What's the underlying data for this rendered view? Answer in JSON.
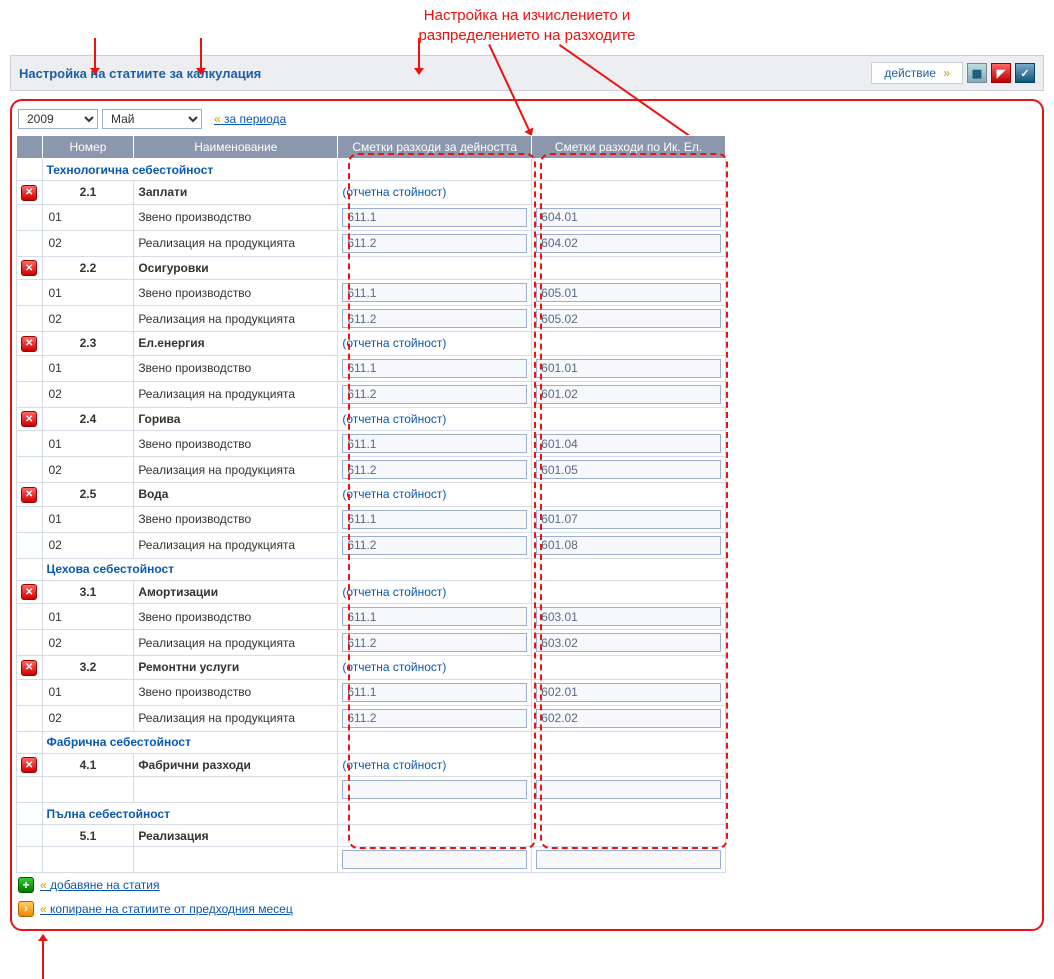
{
  "annotation": {
    "title_line1": "Настройка на изчислението и",
    "title_line2": "разпределението на разходите"
  },
  "header": {
    "title": "Настройка на статиите за калкулация",
    "action_label": "действие"
  },
  "period": {
    "year": "2009",
    "month": "Май",
    "link_text": "за периода"
  },
  "table": {
    "headers": {
      "number": "Номер",
      "name": "Наименование",
      "acct_activity": "Сметки разходи за дейността",
      "acct_econ": "Сметки разходи по Ик. Ел."
    },
    "report_value": "(отчетна стойност)"
  },
  "sections": [
    {
      "title": "Технологична себестойност",
      "items": [
        {
          "num": "2.1",
          "name": "Заплати",
          "report_link": true,
          "rows": [
            {
              "n": "01",
              "nm": "Звено производство",
              "a": "611.1",
              "b": "604.01"
            },
            {
              "n": "02",
              "nm": "Реализация на продукцията",
              "a": "611.2",
              "b": "604.02"
            }
          ]
        },
        {
          "num": "2.2",
          "name": "Осигуровки",
          "report_link": false,
          "rows": [
            {
              "n": "01",
              "nm": "Звено производство",
              "a": "611.1",
              "b": "605.01"
            },
            {
              "n": "02",
              "nm": "Реализация на продукцията",
              "a": "611.2",
              "b": "605.02"
            }
          ]
        },
        {
          "num": "2.3",
          "name": "Ел.енергия",
          "report_link": true,
          "rows": [
            {
              "n": "01",
              "nm": "Звено производство",
              "a": "611.1",
              "b": "601.01"
            },
            {
              "n": "02",
              "nm": "Реализация на продукцията",
              "a": "611.2",
              "b": "601.02"
            }
          ]
        },
        {
          "num": "2.4",
          "name": "Горива",
          "report_link": true,
          "rows": [
            {
              "n": "01",
              "nm": "Звено производство",
              "a": "611.1",
              "b": "601.04"
            },
            {
              "n": "02",
              "nm": "Реализация на продукцията",
              "a": "611.2",
              "b": "601.05"
            }
          ]
        },
        {
          "num": "2.5",
          "name": "Вода",
          "report_link": true,
          "rows": [
            {
              "n": "01",
              "nm": "Звено производство",
              "a": "611.1",
              "b": "601.07"
            },
            {
              "n": "02",
              "nm": "Реализация на продукцията",
              "a": "611.2",
              "b": "601.08"
            }
          ]
        }
      ]
    },
    {
      "title": "Цехова себестойност",
      "items": [
        {
          "num": "3.1",
          "name": "Амортизации",
          "report_link": true,
          "rows": [
            {
              "n": "01",
              "nm": "Звено производство",
              "a": "611.1",
              "b": "603.01"
            },
            {
              "n": "02",
              "nm": "Реализация на продукцията",
              "a": "611.2",
              "b": "603.02"
            }
          ]
        },
        {
          "num": "3.2",
          "name": "Ремонтни услуги",
          "report_link": true,
          "rows": [
            {
              "n": "01",
              "nm": "Звено производство",
              "a": "611.1",
              "b": "602.01"
            },
            {
              "n": "02",
              "nm": "Реализация на продукцията",
              "a": "611.2",
              "b": "602.02"
            }
          ]
        }
      ]
    },
    {
      "title": "Фабрична себестойност",
      "items": [
        {
          "num": "4.1",
          "name": "Фабрични разходи",
          "report_link": true,
          "rows": [
            {
              "n": "",
              "nm": "",
              "a": "",
              "b": ""
            }
          ]
        }
      ]
    },
    {
      "title": "Пълна себестойност",
      "items": [
        {
          "num": "5.1",
          "name": "Реализация",
          "report_link": false,
          "no_delete": true,
          "rows": [
            {
              "n": "",
              "nm": "",
              "a": "",
              "b": ""
            }
          ]
        }
      ]
    }
  ],
  "footer": {
    "add_label": "добавяне на статия",
    "copy_label": "копиране на статиите от предходния месец"
  }
}
